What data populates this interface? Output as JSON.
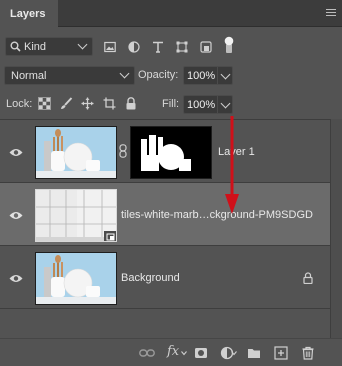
{
  "panel": {
    "tab_label": "Layers",
    "menu_icon": "hamburger-menu-icon"
  },
  "filter": {
    "kind_label": "Kind",
    "icons": [
      "image-filter-icon",
      "adjustment-filter-icon",
      "type-filter-icon",
      "shape-filter-icon",
      "smart-object-filter-icon",
      "filter-toggle-icon"
    ]
  },
  "blend": {
    "mode": "Normal",
    "opacity_label": "Opacity:",
    "opacity_value": "100%"
  },
  "lock": {
    "label": "Lock:",
    "icons": [
      "lock-transparent-pixels-icon",
      "lock-image-pixels-icon",
      "lock-position-icon",
      "lock-artboard-icon",
      "lock-all-icon"
    ],
    "fill_label": "Fill:",
    "fill_value": "100%"
  },
  "layers": [
    {
      "name": "Layer 1",
      "visible": true,
      "has_mask": true,
      "selected": false
    },
    {
      "name": "tiles-white-marb…ckground-PM9SDGD",
      "visible": true,
      "smart_object": true,
      "selected": true
    },
    {
      "name": "Background",
      "visible": true,
      "locked": true,
      "selected": false
    }
  ],
  "annotation": {
    "arrow_color": "#d0101a"
  },
  "bottom_bar": {
    "fx_label": "fx",
    "icons": [
      "link-layers-icon",
      "add-layer-style-icon",
      "add-mask-icon",
      "new-adjustment-layer-icon",
      "new-group-icon",
      "new-layer-icon",
      "delete-layer-icon"
    ]
  },
  "colors": {
    "panel_bg": "#535353",
    "selected_row": "#6b6b6b",
    "field_bg": "#3a3a3a"
  }
}
